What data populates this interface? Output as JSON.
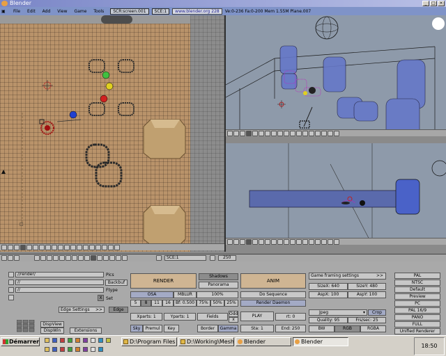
{
  "window": {
    "title": "Blender"
  },
  "menubar": {
    "items": [
      "File",
      "Edit",
      "Add",
      "View",
      "Game",
      "Tools"
    ],
    "screen": "SCR:screen.001",
    "scene": "SCE:1",
    "url": "www.blender.org 228",
    "stats": "Ve:0-236 Fa:0-200  Mem 1.55M  Plane.007"
  },
  "buttons_header": {
    "scene": "SCE:1",
    "frame": "250"
  },
  "render": {
    "pics_label": "Pics",
    "pics_path": "//render/",
    "backbuf_label": "Backbuf",
    "backbuf_path": "//",
    "ftype_label": "Ftype",
    "ftype_path": "//",
    "set_label": "Set",
    "x_btn": "X",
    "edge_settings": "Edge Settings",
    "edge_arrow": ">>",
    "edge": "Edge",
    "dispview": "DispView",
    "dispwin": "DispWin",
    "extensions": "Extensions",
    "render_btn": "RENDER",
    "shadows": "Shadows",
    "panorama": "Panorama",
    "osa": "OSA",
    "mblur": "MBLUR",
    "pct100": "100%",
    "osa_levels": [
      "5",
      "8",
      "11",
      "16"
    ],
    "bf": "Bf: 0.500",
    "pct75": "75%",
    "pct50": "50%",
    "pct25": "25%",
    "xparts": "Xparts: 1",
    "yparts": "Yparts: 1",
    "fields": "Fields",
    "odd": "Odd",
    "x": "x",
    "sky": "Sky",
    "premul": "Premul",
    "key": "Key",
    "border": "Border",
    "gamma": "Gamma",
    "anim_btn": "ANIM",
    "do_sequence": "Do Sequence",
    "render_daemon": "Render Daemon",
    "play": "PLAY",
    "rt": "rt: 0",
    "sta": "Sta: 1",
    "end": "End: 250",
    "game_framing": "Game framing settings",
    "game_arrow": ">>",
    "sizex": "SizeX: 640",
    "sizey": "SizeY: 480",
    "aspx": "AspX: 100",
    "aspy": "AspY: 100",
    "format": "Jpeg",
    "crop": "Crop",
    "quality": "Quality: 95",
    "frs": "Frs/sec: 25",
    "bw": "BW",
    "rgb": "RGB",
    "rgba": "RGBA",
    "presets": [
      "PAL",
      "NTSC",
      "Default",
      "Preview",
      "PC",
      "PAL 16/9",
      "PANO",
      "FULL",
      "Unified Renderer"
    ]
  },
  "taskbar": {
    "start": "Démarrer",
    "tasks": [
      "D:\\Program Files",
      "D:\\Working\\Meshs",
      "Blender",
      "Blender"
    ],
    "clock": "18:50"
  },
  "colors": {
    "titlebar": "#7a86c7",
    "viewport_bg": "#8e9aaa",
    "ground": "#b9936a",
    "render_btn": "#cfb593"
  }
}
